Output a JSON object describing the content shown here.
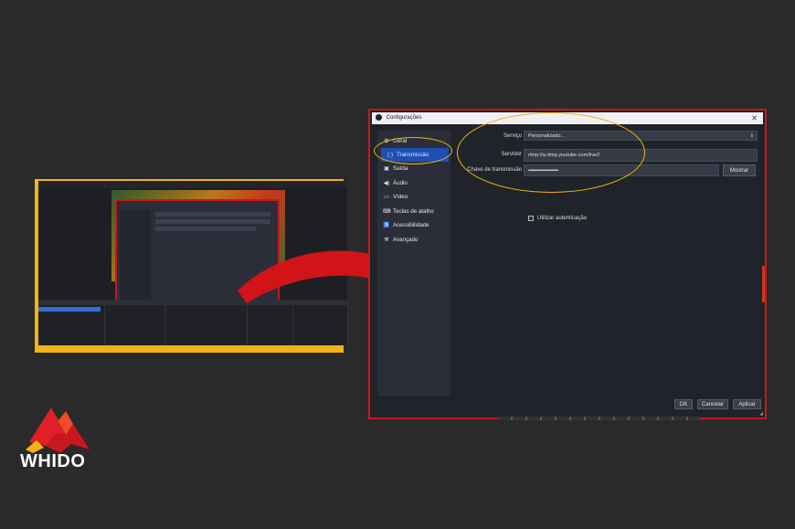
{
  "window": {
    "title": "Configurações",
    "close_glyph": "✕"
  },
  "sidebar": {
    "items": [
      {
        "label": "Geral",
        "icon": "gear-icon",
        "glyph": "⚙"
      },
      {
        "label": "Transmissão",
        "icon": "broadcast-icon",
        "glyph": "(·)"
      },
      {
        "label": "Saída",
        "icon": "output-icon",
        "glyph": "▣"
      },
      {
        "label": "Áudio",
        "icon": "speaker-icon",
        "glyph": "◀)"
      },
      {
        "label": "Vídeo",
        "icon": "monitor-icon",
        "glyph": "▭"
      },
      {
        "label": "Teclas de atalho",
        "icon": "keyboard-icon",
        "glyph": "⌨"
      },
      {
        "label": "Acessibilidade",
        "icon": "accessibility-icon",
        "glyph": "♿"
      },
      {
        "label": "Avançado",
        "icon": "wrench-icon",
        "glyph": "⚒"
      }
    ],
    "active_index": 1
  },
  "stream": {
    "service_label": "Serviço",
    "service_value": "Personalizado...",
    "server_label": "Servidor",
    "server_value": "rtmp://a.rtmp.youtube.com/live2",
    "key_label": "Chave de transmissão",
    "key_value": "••••••••••••••••••••••••",
    "show_button": "Mostrar",
    "auth_label": "Utilizar autenticação"
  },
  "footer": {
    "ok": "OK",
    "cancel": "Cancelar",
    "apply": "Aplicar"
  },
  "brand": {
    "name": "WHIDO"
  },
  "colors": {
    "accent_yellow": "#f2b316",
    "highlight_red": "#c8171d",
    "active_blue": "#1e4fb4"
  }
}
